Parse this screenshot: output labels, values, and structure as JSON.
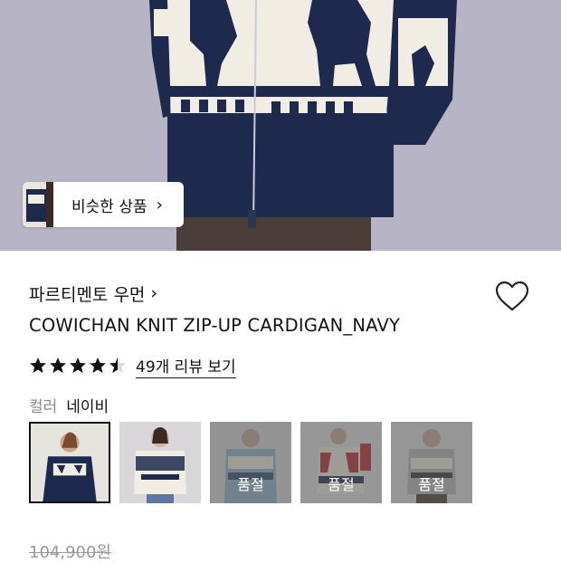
{
  "hero": {
    "similar_label": "비슷한 상품",
    "similar_chevron": "›"
  },
  "product": {
    "brand": "파르티멘토 우먼",
    "brand_chevron": "›",
    "title": "COWICHAN KNIT ZIP-UP CARDIGAN_NAVY",
    "rating": 4.5,
    "review_link": "49개 리뷰 보기",
    "color_label": "컬러",
    "color_value": "네이비",
    "original_price": "104,900원"
  },
  "swatches": [
    {
      "name": "navy",
      "selected": true,
      "sold_out": false,
      "label": ""
    },
    {
      "name": "cream",
      "selected": false,
      "sold_out": false,
      "label": ""
    },
    {
      "name": "sky",
      "selected": false,
      "sold_out": true,
      "label": "품절"
    },
    {
      "name": "red-white",
      "selected": false,
      "sold_out": true,
      "label": "품절"
    },
    {
      "name": "grey",
      "selected": false,
      "sold_out": true,
      "label": "품절"
    }
  ],
  "colors": {
    "navy": "#1d2a4d",
    "cream": "#f1ede3",
    "star": "#111111",
    "muted": "#9a9a9a"
  },
  "icons": [
    "chevron-right-icon",
    "heart-outline-icon",
    "star-icon",
    "star-half-icon"
  ]
}
